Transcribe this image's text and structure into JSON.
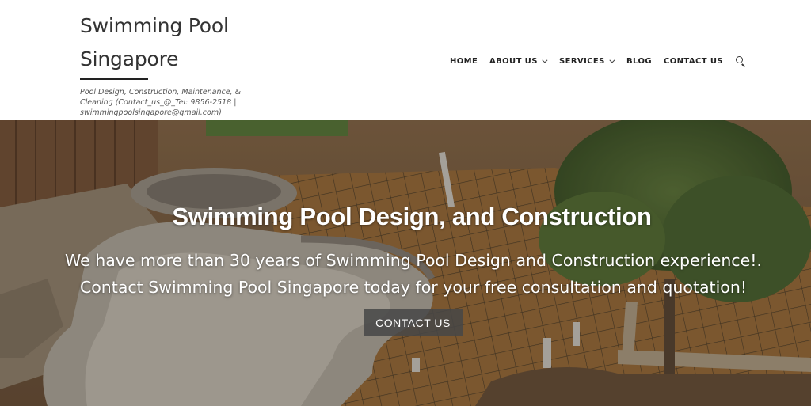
{
  "site": {
    "title_line1": "Swimming Pool",
    "title_line2": "Singapore",
    "tagline": "Pool Design, Construction, Maintenance, & Cleaning (Contact_us_@_Tel: 9856-2518 | swimmingpoolsingapore@gmail.com)"
  },
  "nav": {
    "home": "HOME",
    "about": "ABOUT US",
    "services": "SERVICES",
    "blog": "BLOG",
    "contact": "CONTACT US",
    "search_icon": "search-icon"
  },
  "hero": {
    "title": "Swimming Pool Design, and Construction",
    "text": "We have more than 30 years of Swimming Pool Design and Construction experience!. Contact Swimming Pool Singapore today for your free consultation and quotation!",
    "button": "CONTACT US",
    "image": "pool-construction-site-photo"
  },
  "colors": {
    "text_dark": "#222222",
    "hero_button": "#464646",
    "hero_text": "#ffffff"
  }
}
